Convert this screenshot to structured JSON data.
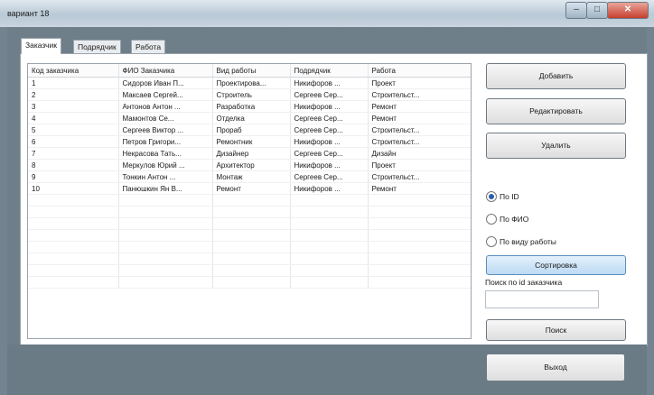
{
  "window": {
    "title": "вариант 18",
    "min": "–",
    "max": "□",
    "close": "✕"
  },
  "tabs": [
    {
      "label": "Заказчик"
    },
    {
      "label": "Подрядчик"
    },
    {
      "label": "Работа"
    }
  ],
  "table": {
    "columns": [
      "Код заказчика",
      "ФИО Заказчика",
      "Вид работы",
      "Подрядчик",
      "Работа"
    ],
    "rows": [
      [
        "1",
        "Сидоров Иван П...",
        "Проектирова...",
        "Никифоров ...",
        "Проект"
      ],
      [
        "2",
        "Максаев Сергей...",
        "Строитель",
        "Сергеев Сер...",
        "Строительст..."
      ],
      [
        "3",
        "Антонов Антон ...",
        "Разработка",
        "Никифоров ...",
        "Ремонт"
      ],
      [
        "4",
        "Мамонтов Се...",
        "Отделка",
        "Сергеев Сер...",
        "Ремонт"
      ],
      [
        "5",
        "Сергеев Виктор ...",
        "Прораб",
        "Сергеев Сер...",
        "Строительст..."
      ],
      [
        "6",
        "Петров Григори...",
        "Ремонтник",
        "Никифоров ...",
        "Строительст..."
      ],
      [
        "7",
        "Некрасова Тать...",
        "Дизайнер",
        "Сергеев Сер...",
        "Дизайн"
      ],
      [
        "8",
        "Меркулов Юрий ...",
        "Архитектор",
        "Никифоров ...",
        "Проект"
      ],
      [
        "9",
        "Тонкин Антон ...",
        "Монтаж",
        "Сергеев Сер...",
        "Строительст..."
      ],
      [
        "10",
        "Панюшкин Ян В...",
        "Ремонт",
        "Никифоров ...",
        "Ремонт"
      ]
    ],
    "empty_rows": 8
  },
  "buttons": {
    "add": "Добавить",
    "edit": "Редактировать",
    "delete": "Удалить",
    "sort": "Сортировка",
    "search": "Поиск",
    "exit": "Выход"
  },
  "radios": [
    {
      "label": "По ID",
      "checked": true
    },
    {
      "label": "По ФИО",
      "checked": false
    },
    {
      "label": "По виду работы",
      "checked": false
    }
  ],
  "search": {
    "label": "Поиск по id заказчика",
    "value": ""
  }
}
